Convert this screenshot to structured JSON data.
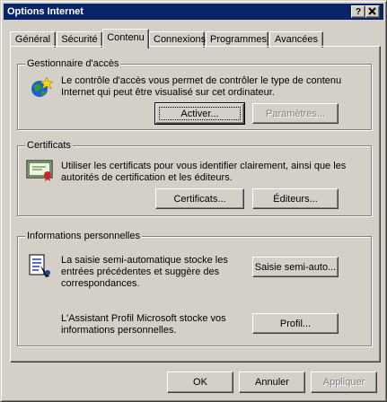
{
  "window": {
    "title": "Options Internet",
    "help_button": "?",
    "close_button": "X"
  },
  "tabs": [
    {
      "label": "Général"
    },
    {
      "label": "Sécurité"
    },
    {
      "label": "Contenu"
    },
    {
      "label": "Connexions"
    },
    {
      "label": "Programmes"
    },
    {
      "label": "Avancées"
    }
  ],
  "content_advisor": {
    "title": "Gestionnaire d'accès",
    "description_line1": "Le contrôle d'accès vous permet de contrôler le type de contenu",
    "description_line2": "Internet qui peut être visualisé sur cet ordinateur.",
    "enable_button": "Activer...",
    "settings_button": "Paramètres...",
    "icon": "content-advisor-globe-icon"
  },
  "certificates": {
    "title": "Certificats",
    "description_line1": "Utiliser les certificats pour vous identifier clairement, ainsi que les",
    "description_line2": "autorités de certification et les éditeurs.",
    "certificates_button": "Certificats...",
    "publishers_button": "Éditeurs...",
    "icon": "certificate-icon"
  },
  "personal_info": {
    "title": "Informations personnelles",
    "autocomplete_line1": "La saisie semi-automatique stocke les",
    "autocomplete_line2": "entrées précédentes et suggère des",
    "autocomplete_line3": "correspondances.",
    "autocomplete_button": "Saisie semi-auto...",
    "profile_line1": "L'Assistant Profil Microsoft stocke vos",
    "profile_line2": "informations personnelles.",
    "profile_button": "Profil...",
    "icon": "autocomplete-icon"
  },
  "footer": {
    "ok_button": "OK",
    "cancel_button": "Annuler",
    "apply_button": "Appliquer"
  }
}
